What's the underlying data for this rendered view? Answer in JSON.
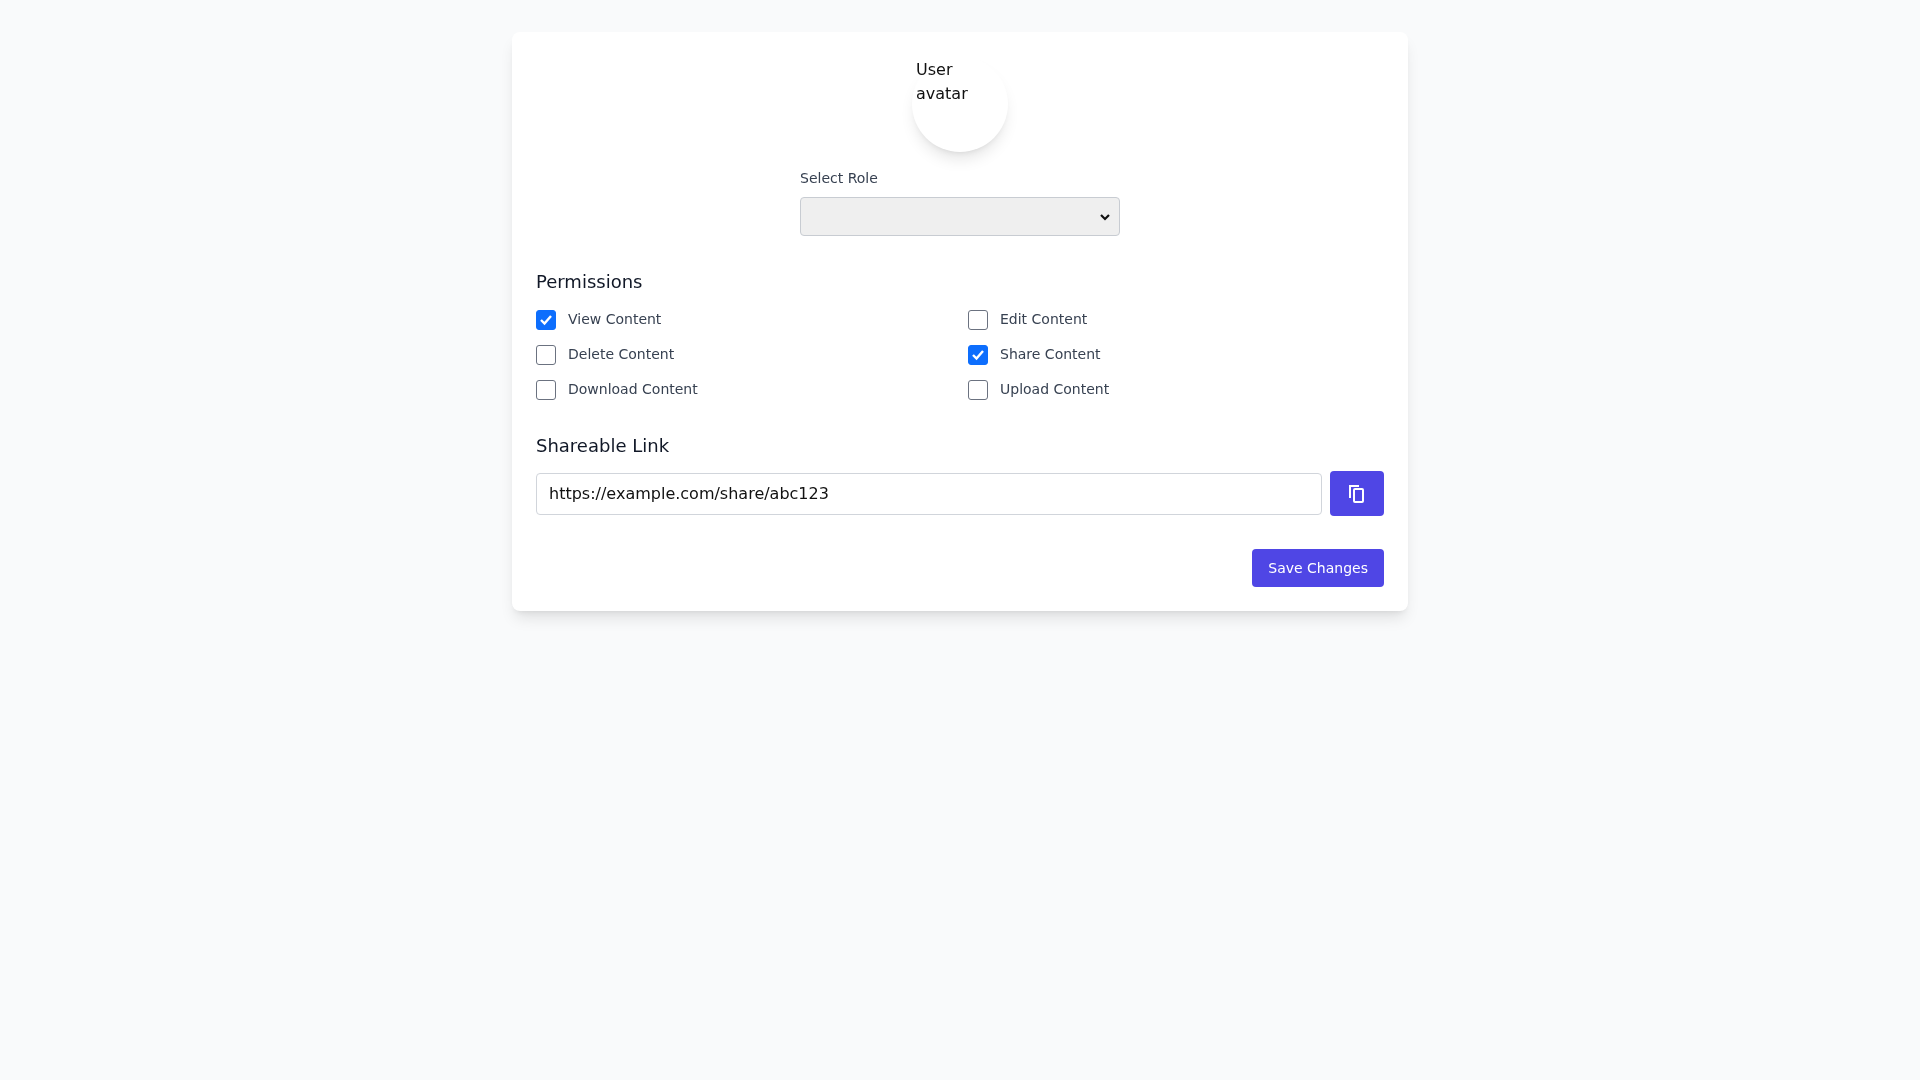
{
  "avatar": {
    "alt_text": "User avatar"
  },
  "role_select": {
    "label": "Select Role"
  },
  "permissions": {
    "heading": "Permissions",
    "items": [
      {
        "label": "View Content",
        "checked": true
      },
      {
        "label": "Edit Content",
        "checked": false
      },
      {
        "label": "Delete Content",
        "checked": false
      },
      {
        "label": "Share Content",
        "checked": true
      },
      {
        "label": "Download Content",
        "checked": false
      },
      {
        "label": "Upload Content",
        "checked": false
      }
    ]
  },
  "shareable_link": {
    "heading": "Shareable Link",
    "value": "https://example.com/share/abc123"
  },
  "save_button": "Save Changes"
}
